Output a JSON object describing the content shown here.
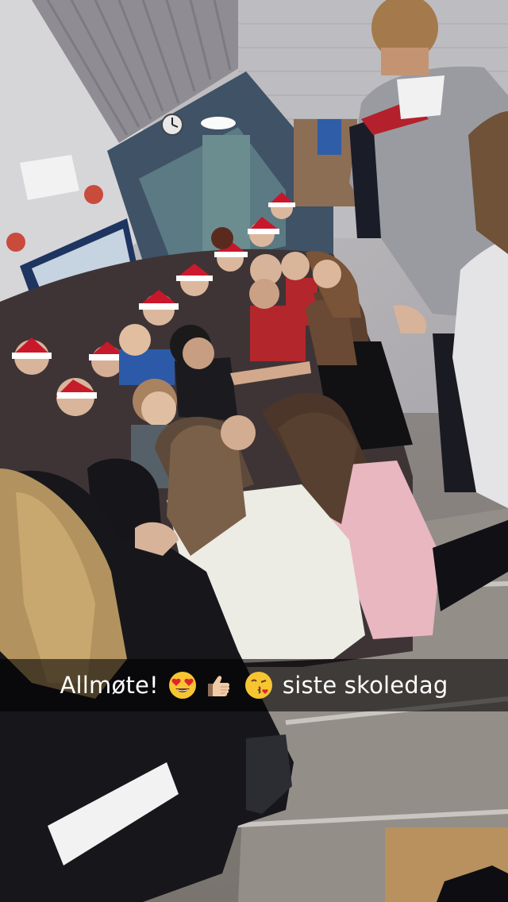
{
  "snap": {
    "caption": {
      "text_before": "Allmøte!",
      "text_after": "siste skoledag",
      "emojis": [
        "heart-eyes-emoji-icon",
        "thumbs-up-emoji-icon",
        "kiss-emoji-icon"
      ]
    }
  }
}
